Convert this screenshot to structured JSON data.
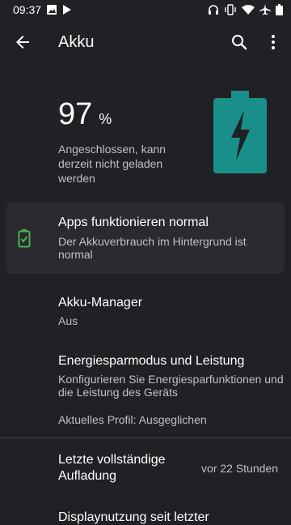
{
  "status_bar": {
    "time": "09:37",
    "left_icons": [
      "image-icon",
      "play-store-icon"
    ],
    "right_icons": [
      "headset-icon",
      "vibrate-icon",
      "wifi-icon",
      "airplane-icon",
      "battery-icon"
    ]
  },
  "app_bar": {
    "title": "Akku",
    "back_icon": "arrow-back-icon",
    "search_icon": "search-icon",
    "more_icon": "more-vert-icon"
  },
  "battery": {
    "percent": "97",
    "percent_sign": "%",
    "status_text": "Angeschlossen, kann derzeit nicht geladen werden",
    "level": 0.97,
    "accent_color": "#1a8f8a"
  },
  "tip": {
    "title": "Apps funktionieren normal",
    "subtitle": "Der Akkuverbrauch im Hintergrund ist normal",
    "icon": "battery-ok-icon",
    "icon_color": "#4caf50"
  },
  "items": {
    "manager_title": "Akku-Manager",
    "manager_sub": "Aus",
    "saver_title": "Energiesparmodus und Leistung",
    "saver_sub": "Konfigurieren Sie Energiesparfunktionen und die Leistung des Geräts",
    "saver_profile": "Aktuelles Profil: Ausgeglichen",
    "last_charge_title": "Letzte vollständige Aufladung",
    "last_charge_value": "vor 22 Stunden",
    "screen_usage_title": "Displaynutzung seit letzter"
  }
}
